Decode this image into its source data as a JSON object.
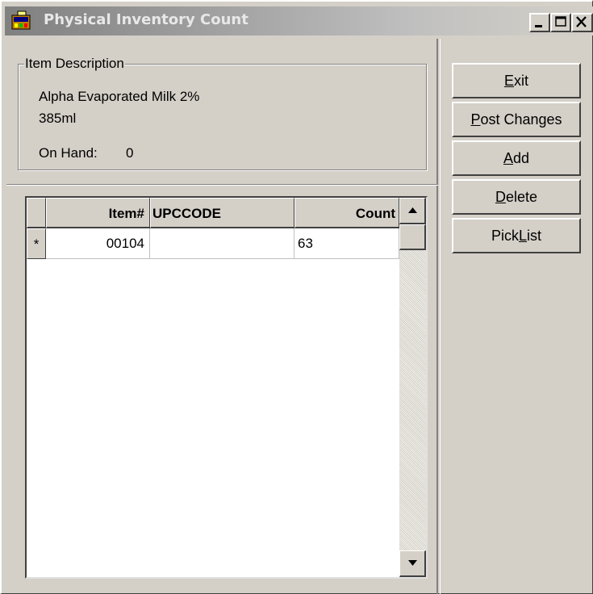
{
  "window": {
    "title": "Physical Inventory Count",
    "controls": {
      "minimize_icon": "minimize-icon",
      "maximize_icon": "maximize-icon",
      "close_icon": "close-icon"
    },
    "title_gradient": [
      "#808080",
      "#d4d0c8"
    ],
    "face_color": "#d4d0c8"
  },
  "item_description": {
    "legend": "Item Description",
    "line1": "Alpha Evaporated Milk 2%",
    "line2": "385ml",
    "on_hand_label": "On Hand:",
    "on_hand_value": "0"
  },
  "grid": {
    "columns": [
      "Item#",
      "UPCCODE",
      "Count"
    ],
    "rows": [
      {
        "marker": "*",
        "item": "00104",
        "upc": "",
        "count": "63"
      }
    ]
  },
  "buttons": {
    "exit": {
      "pre": "",
      "ul": "E",
      "post": "xit"
    },
    "post": {
      "pre": "",
      "ul": "P",
      "post": "ost Changes"
    },
    "add": {
      "pre": "",
      "ul": "A",
      "post": "dd"
    },
    "delete": {
      "pre": "",
      "ul": "D",
      "post": "elete"
    },
    "picklist": {
      "pre": "Pick",
      "ul": "L",
      "post": "ist"
    }
  }
}
